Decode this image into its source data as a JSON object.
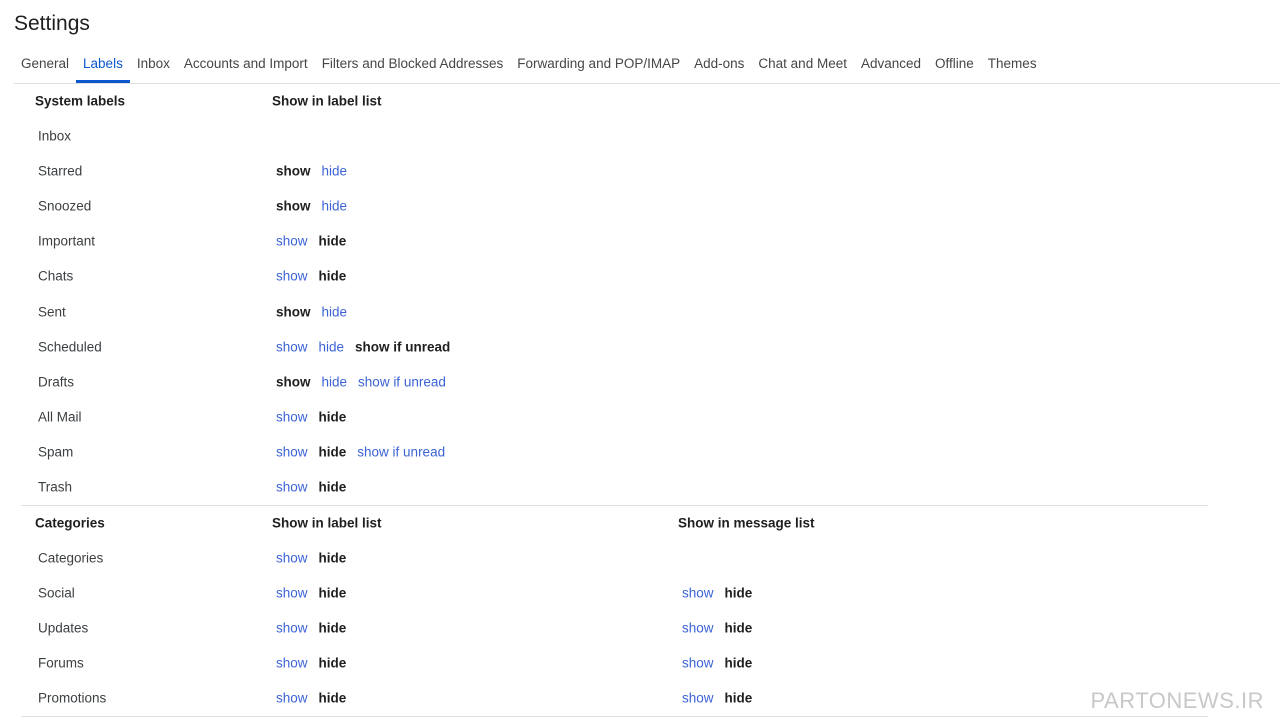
{
  "page_title": "Settings",
  "tabs": [
    {
      "label": "General",
      "active": false
    },
    {
      "label": "Labels",
      "active": true
    },
    {
      "label": "Inbox",
      "active": false
    },
    {
      "label": "Accounts and Import",
      "active": false
    },
    {
      "label": "Filters and Blocked Addresses",
      "active": false
    },
    {
      "label": "Forwarding and POP/IMAP",
      "active": false
    },
    {
      "label": "Add-ons",
      "active": false
    },
    {
      "label": "Chat and Meet",
      "active": false
    },
    {
      "label": "Advanced",
      "active": false
    },
    {
      "label": "Offline",
      "active": false
    },
    {
      "label": "Themes",
      "active": false
    }
  ],
  "system_labels": {
    "heading": "System labels",
    "col_label_list": "Show in label list",
    "rows": [
      {
        "name": "Inbox",
        "options": []
      },
      {
        "name": "Starred",
        "options": [
          {
            "text": "show",
            "selected": true
          },
          {
            "text": "hide",
            "selected": false
          }
        ]
      },
      {
        "name": "Snoozed",
        "options": [
          {
            "text": "show",
            "selected": true
          },
          {
            "text": "hide",
            "selected": false
          }
        ]
      },
      {
        "name": "Important",
        "options": [
          {
            "text": "show",
            "selected": false
          },
          {
            "text": "hide",
            "selected": true
          }
        ]
      },
      {
        "name": "Chats",
        "options": [
          {
            "text": "show",
            "selected": false
          },
          {
            "text": "hide",
            "selected": true
          }
        ]
      },
      {
        "name": "Sent",
        "options": [
          {
            "text": "show",
            "selected": true
          },
          {
            "text": "hide",
            "selected": false
          }
        ]
      },
      {
        "name": "Scheduled",
        "options": [
          {
            "text": "show",
            "selected": false
          },
          {
            "text": "hide",
            "selected": false
          },
          {
            "text": "show if unread",
            "selected": true
          }
        ]
      },
      {
        "name": "Drafts",
        "options": [
          {
            "text": "show",
            "selected": true
          },
          {
            "text": "hide",
            "selected": false
          },
          {
            "text": "show if unread",
            "selected": false
          }
        ]
      },
      {
        "name": "All Mail",
        "options": [
          {
            "text": "show",
            "selected": false
          },
          {
            "text": "hide",
            "selected": true
          }
        ]
      },
      {
        "name": "Spam",
        "options": [
          {
            "text": "show",
            "selected": false
          },
          {
            "text": "hide",
            "selected": true
          },
          {
            "text": "show if unread",
            "selected": false
          }
        ]
      },
      {
        "name": "Trash",
        "options": [
          {
            "text": "show",
            "selected": false
          },
          {
            "text": "hide",
            "selected": true
          }
        ]
      }
    ]
  },
  "categories": {
    "heading": "Categories",
    "col_label_list": "Show in label list",
    "col_message_list": "Show in message list",
    "rows": [
      {
        "name": "Categories",
        "label_options": [
          {
            "text": "show",
            "selected": false
          },
          {
            "text": "hide",
            "selected": true
          }
        ],
        "message_options": []
      },
      {
        "name": "Social",
        "label_options": [
          {
            "text": "show",
            "selected": false
          },
          {
            "text": "hide",
            "selected": true
          }
        ],
        "message_options": [
          {
            "text": "show",
            "selected": false
          },
          {
            "text": "hide",
            "selected": true
          }
        ]
      },
      {
        "name": "Updates",
        "label_options": [
          {
            "text": "show",
            "selected": false
          },
          {
            "text": "hide",
            "selected": true
          }
        ],
        "message_options": [
          {
            "text": "show",
            "selected": false
          },
          {
            "text": "hide",
            "selected": true
          }
        ]
      },
      {
        "name": "Forums",
        "label_options": [
          {
            "text": "show",
            "selected": false
          },
          {
            "text": "hide",
            "selected": true
          }
        ],
        "message_options": [
          {
            "text": "show",
            "selected": false
          },
          {
            "text": "hide",
            "selected": true
          }
        ]
      },
      {
        "name": "Promotions",
        "label_options": [
          {
            "text": "show",
            "selected": false
          },
          {
            "text": "hide",
            "selected": true
          }
        ],
        "message_options": [
          {
            "text": "show",
            "selected": false
          },
          {
            "text": "hide",
            "selected": true
          }
        ]
      }
    ]
  },
  "watermark": "PARTONEWS.IR",
  "colors": {
    "accent": "#0b57d0",
    "link": "#3c63d6",
    "text": "#1f1f1f"
  }
}
